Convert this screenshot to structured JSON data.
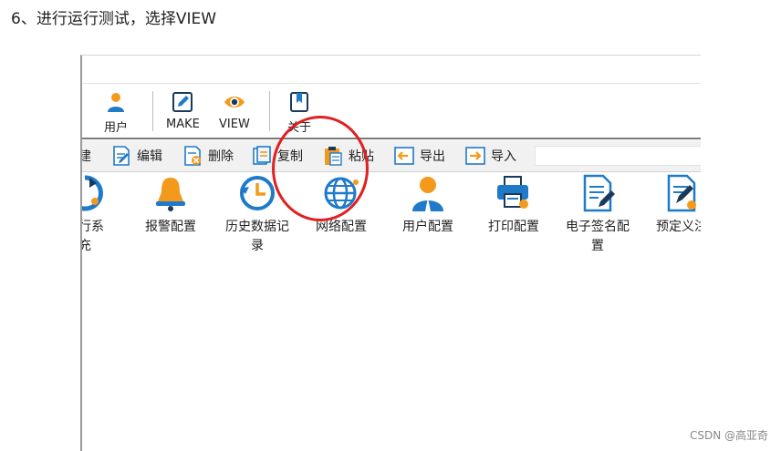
{
  "caption": "6、进行运行测试，选择VIEW",
  "ribbon": {
    "user": "用户",
    "make": "MAKE",
    "view": "VIEW",
    "about": "关于"
  },
  "toolbar": {
    "new": "建",
    "edit": "编辑",
    "delete": "删除",
    "copy": "复制",
    "paste": "粘贴",
    "export": "导出",
    "import": "导入"
  },
  "grid": {
    "items": [
      {
        "line1": "运行系",
        "line2": "充",
        "icon": "run-icon"
      },
      {
        "line1": "报警配置",
        "line2": "",
        "icon": "bell-icon"
      },
      {
        "line1": "历史数据记",
        "line2": "录",
        "icon": "history-clock-icon"
      },
      {
        "line1": "网络配置",
        "line2": "",
        "icon": "globe-icon"
      },
      {
        "line1": "用户配置",
        "line2": "",
        "icon": "user-icon"
      },
      {
        "line1": "打印配置",
        "line2": "",
        "icon": "printer-icon"
      },
      {
        "line1": "电子签名配",
        "line2": "置",
        "icon": "signature-doc-icon"
      },
      {
        "line1": "预定义注",
        "line2": "",
        "icon": "predefined-doc-icon"
      }
    ]
  },
  "watermark": "CSDN @高亚奇",
  "colors": {
    "accent": "#1f7ac9",
    "orange": "#f39a1c",
    "annotation": "#e02020"
  }
}
